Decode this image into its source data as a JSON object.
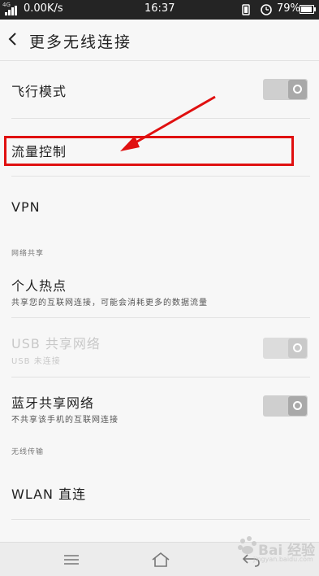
{
  "status_bar": {
    "network_type": "4G",
    "speed": "0.00K/s",
    "time": "16:37",
    "battery": "79%"
  },
  "header": {
    "title": "更多无线连接",
    "back_icon": "chevron-left-icon"
  },
  "rows": {
    "airplane": {
      "title": "飞行模式",
      "toggle_on": false
    },
    "traffic": {
      "title": "流量控制"
    },
    "vpn": {
      "title": "VPN"
    },
    "section_network_sharing": "网络共享",
    "hotspot": {
      "title": "个人热点",
      "subtitle": "共享您的互联网连接，可能会消耗更多的数据流量"
    },
    "usb": {
      "title": "USB 共享网络",
      "subtitle": "USB 未连接",
      "toggle_on": false,
      "enabled": false
    },
    "bluetooth": {
      "title": "蓝牙共享网络",
      "subtitle": "不共享该手机的互联网连接",
      "toggle_on": false
    },
    "section_wireless": "无线传输",
    "wlan_direct": {
      "title": "WLAN 直连"
    }
  },
  "nav_bar": {
    "menu_icon": "menu-icon",
    "home_icon": "home-icon",
    "back_icon": "back-arrow-icon"
  },
  "watermark": {
    "text": "Bai 经验",
    "url": "jingyan.baidu.com"
  },
  "colors": {
    "annotation": "#e01010",
    "background": "#f7f7f7",
    "status_bar": "#242424"
  }
}
